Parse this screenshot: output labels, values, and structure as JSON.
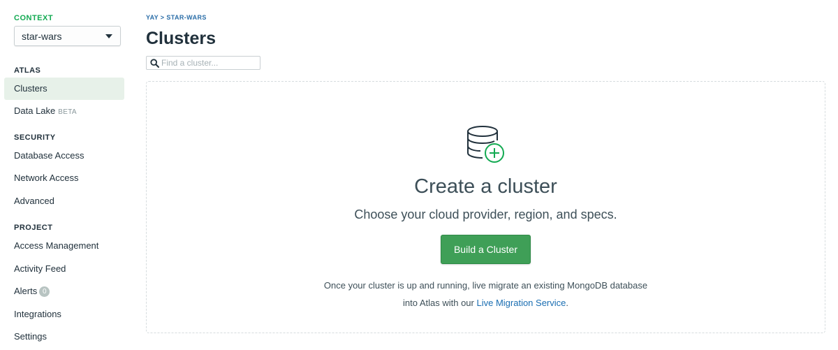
{
  "sidebar": {
    "context_label": "CONTEXT",
    "context_value": "star-wars",
    "sections": {
      "atlas": "ATLAS",
      "security": "SECURITY",
      "project": "PROJECT"
    },
    "items": {
      "clusters": "Clusters",
      "data_lake": "Data Lake",
      "data_lake_badge": "BETA",
      "database_access": "Database Access",
      "network_access": "Network Access",
      "advanced": "Advanced",
      "access_management": "Access Management",
      "activity_feed": "Activity Feed",
      "alerts": "Alerts",
      "alerts_count": "0",
      "integrations": "Integrations",
      "settings": "Settings"
    }
  },
  "header": {
    "breadcrumb": "YAY > STAR-WARS",
    "title": "Clusters",
    "search_placeholder": "Find a cluster..."
  },
  "empty_state": {
    "icon": "database-plus-icon",
    "title": "Create a cluster",
    "subtitle": "Choose your cloud provider, region, and specs.",
    "button_label": "Build a Cluster",
    "note_line1": "Once your cluster is up and running, live migrate an existing MongoDB database",
    "note_line2_prefix": "into Atlas with our ",
    "note_link": "Live Migration Service",
    "note_suffix": "."
  },
  "colors": {
    "accent_green": "#13aa52",
    "button_green": "#3f9f57",
    "active_bg": "#e7f1e9",
    "link_blue": "#1a6eb2"
  }
}
